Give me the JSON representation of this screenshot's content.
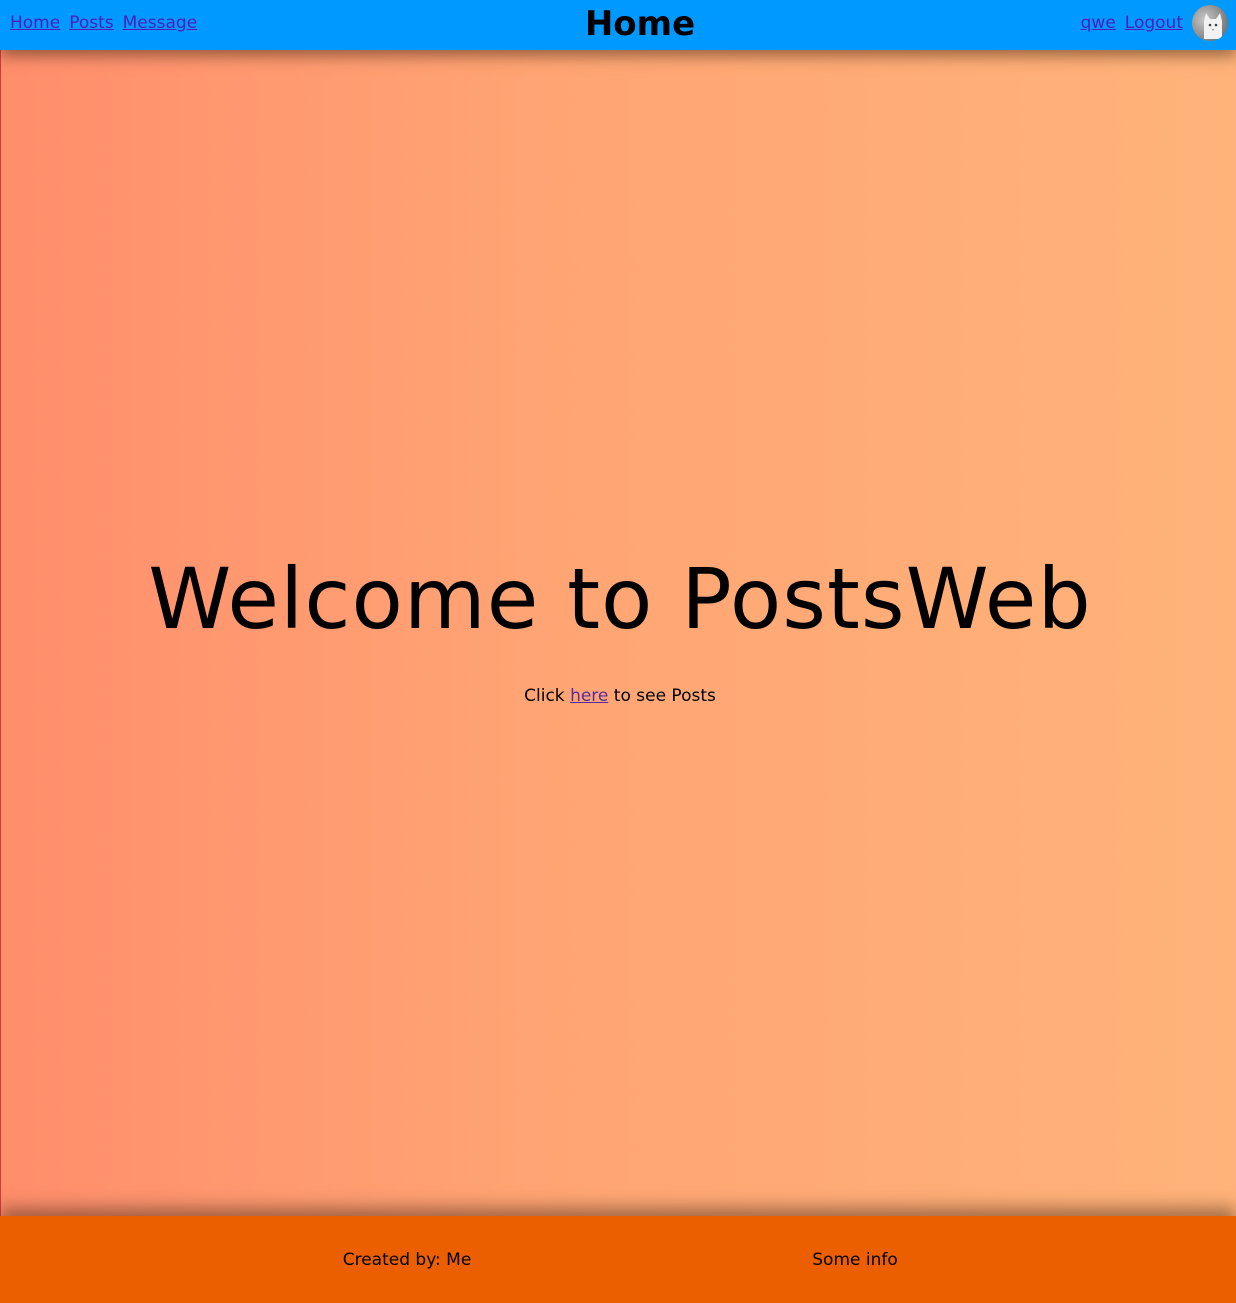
{
  "header": {
    "title": "Home",
    "nav_left": [
      "Home",
      "Posts",
      "Message"
    ],
    "username": "qwe",
    "logout_label": "Logout",
    "avatar_icon": "cat-avatar-icon",
    "background_color": "#0099ff",
    "link_color": "#4b1fb8"
  },
  "main": {
    "welcome": "Welcome to PostsWeb",
    "cta_prefix": "Click",
    "cta_link": "here",
    "cta_suffix": "to see Posts",
    "gradient": [
      "#ff8e6c",
      "#ffb379"
    ]
  },
  "footer": {
    "created_by": "Created by: Me",
    "info": "Some info",
    "background_color": "#eb5f00"
  }
}
